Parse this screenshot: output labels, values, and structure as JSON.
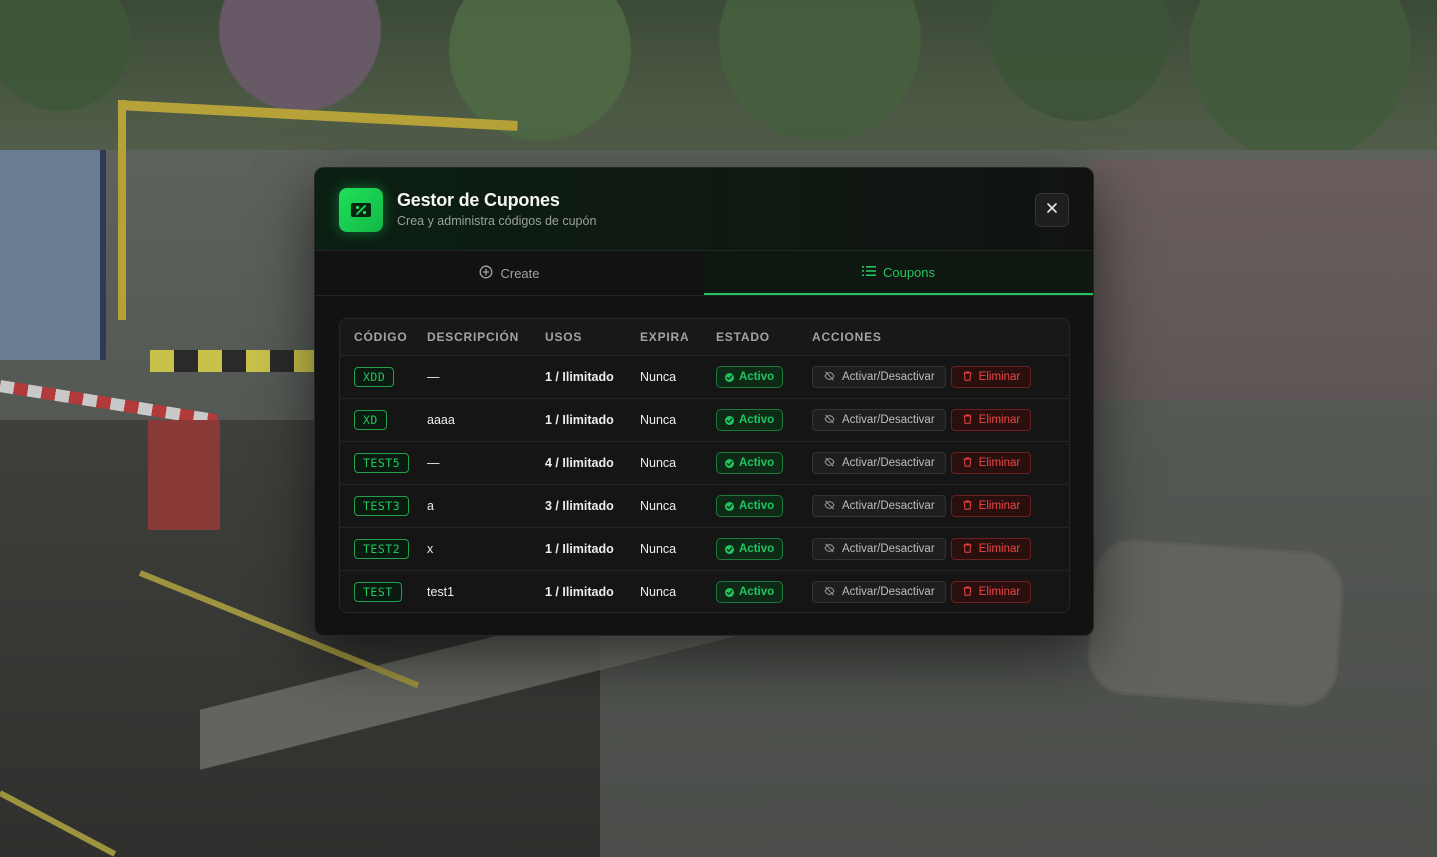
{
  "modal": {
    "title": "Gestor de Cupones",
    "subtitle": "Crea y administra códigos de cupón"
  },
  "icons": {
    "logo": "ticket-percent-icon",
    "close": "close-icon",
    "create_tab": "plus-circle-icon",
    "coupons_tab": "list-icon",
    "status": "check-circle-icon",
    "toggle": "eye-off-icon",
    "delete": "trash-icon"
  },
  "colors": {
    "accent": "#22c55e",
    "danger": "#ef4444",
    "background": "#121212"
  },
  "tabs": {
    "create": "Create",
    "coupons": "Coupons",
    "active": "coupons"
  },
  "table": {
    "headers": {
      "code": "CÓDIGO",
      "description": "DESCRIPCIÓN",
      "uses": "USOS",
      "expires": "EXPIRA",
      "status": "ESTADO",
      "actions": "ACCIONES"
    },
    "rows": [
      {
        "code": "XDD",
        "description": "—",
        "uses": "1 / Ilimitado",
        "expires": "Nunca",
        "status": "Activo",
        "toggle_label": "Activar/Desactivar",
        "delete_label": "Eliminar"
      },
      {
        "code": "XD",
        "description": "aaaa",
        "uses": "1 / Ilimitado",
        "expires": "Nunca",
        "status": "Activo",
        "toggle_label": "Activar/Desactivar",
        "delete_label": "Eliminar"
      },
      {
        "code": "TEST5",
        "description": "—",
        "uses": "4 / Ilimitado",
        "expires": "Nunca",
        "status": "Activo",
        "toggle_label": "Activar/Desactivar",
        "delete_label": "Eliminar"
      },
      {
        "code": "TEST3",
        "description": "a",
        "uses": "3 / Ilimitado",
        "expires": "Nunca",
        "status": "Activo",
        "toggle_label": "Activar/Desactivar",
        "delete_label": "Eliminar"
      },
      {
        "code": "TEST2",
        "description": "x",
        "uses": "1 / Ilimitado",
        "expires": "Nunca",
        "status": "Activo",
        "toggle_label": "Activar/Desactivar",
        "delete_label": "Eliminar"
      },
      {
        "code": "TEST",
        "description": "test1",
        "uses": "1 / Ilimitado",
        "expires": "Nunca",
        "status": "Activo",
        "toggle_label": "Activar/Desactivar",
        "delete_label": "Eliminar"
      }
    ]
  }
}
